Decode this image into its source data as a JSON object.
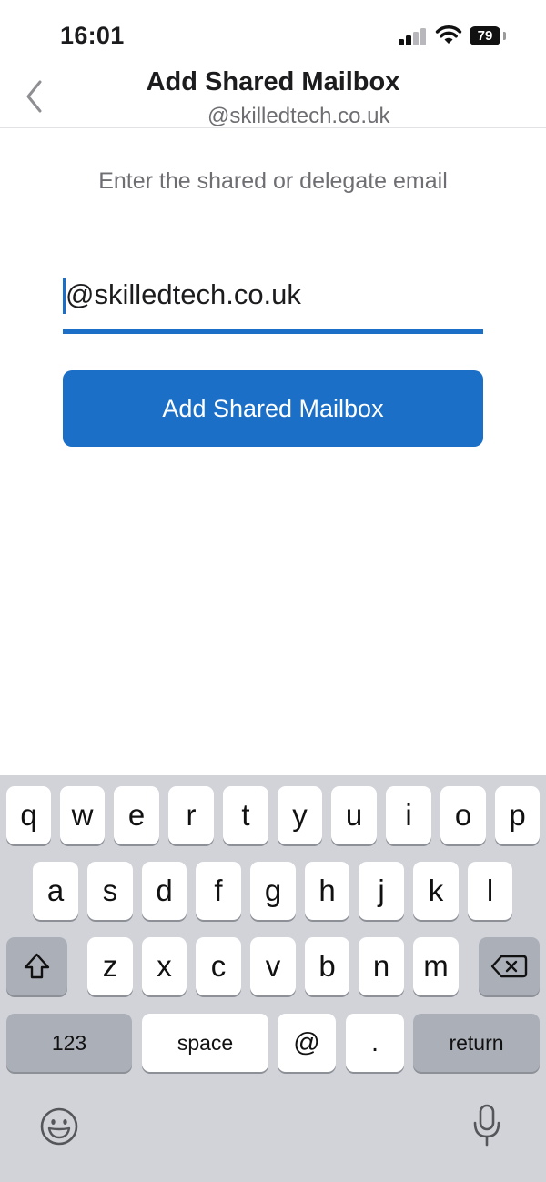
{
  "status_bar": {
    "time": "16:01",
    "battery": "79"
  },
  "nav": {
    "title": "Add Shared Mailbox",
    "subtitle": "@skilledtech.co.uk"
  },
  "form": {
    "prompt": "Enter the shared or delegate email",
    "email_value": "@skilledtech.co.uk",
    "submit_label": "Add Shared Mailbox"
  },
  "keyboard": {
    "row1": [
      "q",
      "w",
      "e",
      "r",
      "t",
      "y",
      "u",
      "i",
      "o",
      "p"
    ],
    "row2": [
      "a",
      "s",
      "d",
      "f",
      "g",
      "h",
      "j",
      "k",
      "l"
    ],
    "row3": [
      "z",
      "x",
      "c",
      "v",
      "b",
      "n",
      "m"
    ],
    "numbers_label": "123",
    "space_label": "space",
    "at_label": "@",
    "dot_label": ".",
    "return_label": "return",
    "icons": [
      "shift-icon",
      "delete-icon",
      "emoji-icon",
      "microphone-icon"
    ]
  },
  "colors": {
    "accent": "#1b6fc7",
    "keyboard_bg": "#d1d3d9",
    "dark_key": "#abafb8"
  }
}
